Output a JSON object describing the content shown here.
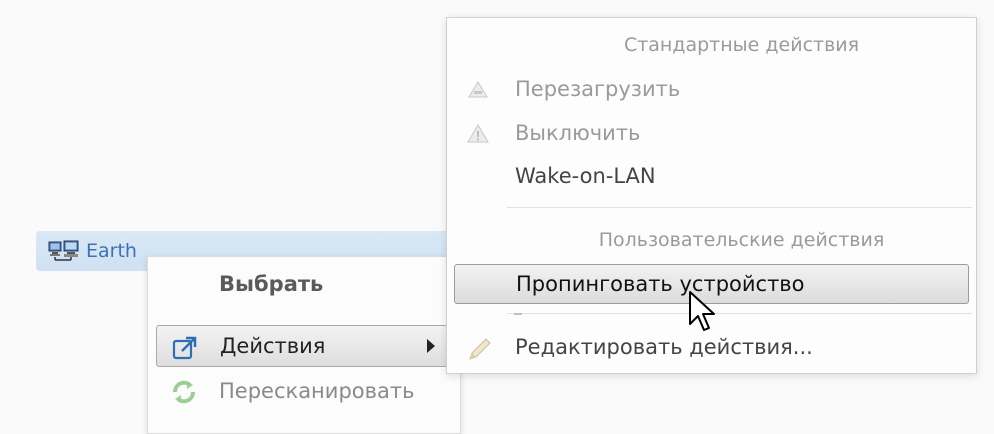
{
  "node": {
    "label": "Earth",
    "icon": "network-computer-icon"
  },
  "context_menu": {
    "items": [
      {
        "label": "Выбрать",
        "icon": ""
      },
      {
        "label": "Действия",
        "icon": "external-link-icon",
        "has_submenu": true
      },
      {
        "label": "Пересканировать",
        "icon": "refresh-icon"
      }
    ]
  },
  "submenu": {
    "standard_title": "Стандартные действия",
    "standard_items": [
      {
        "label": "Перезагрузить",
        "icon": "restart-icon"
      },
      {
        "label": "Выключить",
        "icon": "warning-icon"
      },
      {
        "label": "Wake-on-LAN",
        "icon": ""
      }
    ],
    "user_title": "Пользовательские действия",
    "user_items": [
      {
        "label": "Пропинговать устройство",
        "icon": ""
      }
    ],
    "edit_item": {
      "label": "Редактировать действия...",
      "icon": "pencil-icon"
    }
  },
  "colors": {
    "node_text": "#3b72b6",
    "node_highlight": "#d9e8f6",
    "hover_border": "#9c9c9c"
  }
}
